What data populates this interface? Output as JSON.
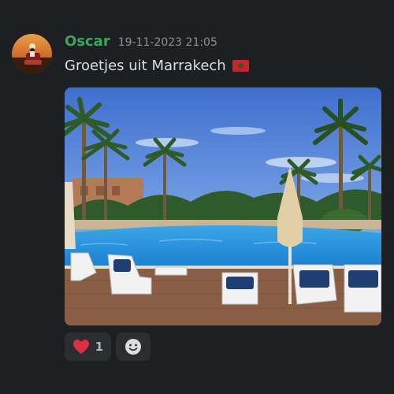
{
  "message": {
    "author": "Oscar",
    "timestamp": "19-11-2023 21:05",
    "text": "Groetjes uit Marrakech",
    "text_emoji": "morocco-flag",
    "author_color": "#3ba55c"
  },
  "attachment": {
    "type": "image",
    "subject": "hotel pool with palm trees and sun loungers"
  },
  "reactions": [
    {
      "emoji": "heart-icon",
      "count": "1"
    }
  ],
  "add_reaction": {
    "icon": "add-reaction-icon"
  },
  "colors": {
    "background": "#1e1f22",
    "reaction_bg": "#2b2d31",
    "text": "#dcddde",
    "timestamp": "#8e9297"
  }
}
